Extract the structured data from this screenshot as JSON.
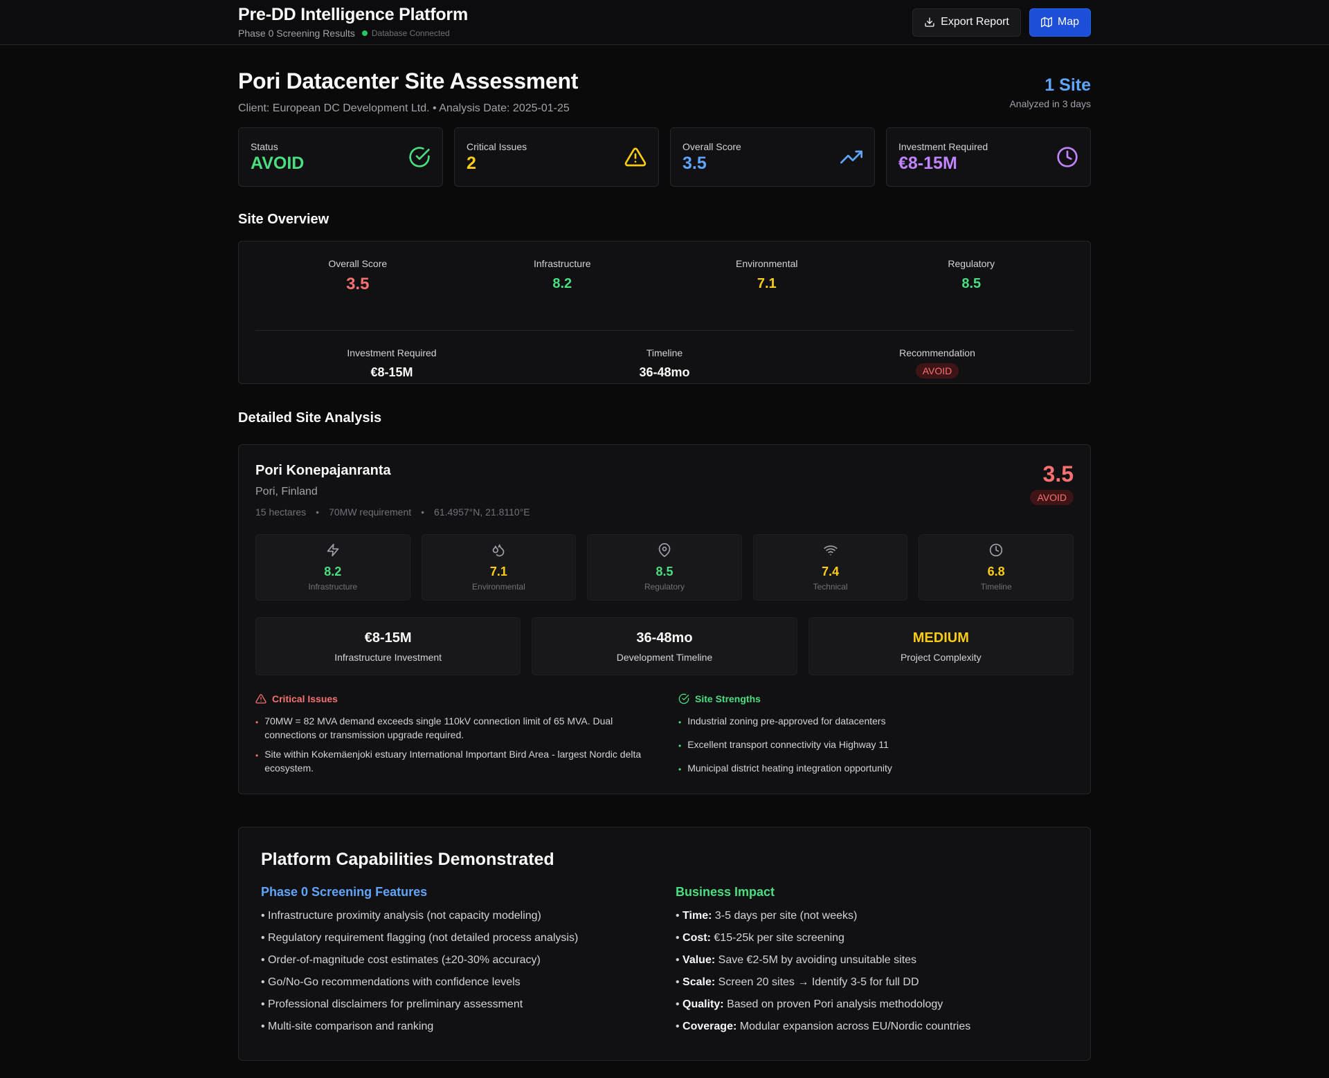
{
  "header": {
    "title": "Pre-DD Intelligence Platform",
    "phase": "Phase 0 Screening Results",
    "db_status": "Database Connected",
    "export_label": "Export Report",
    "map_label": "Map"
  },
  "assessment": {
    "title": "Pori Datacenter Site Assessment",
    "subtitle": "Client: European DC Development Ltd. • Analysis Date: 2025-01-25",
    "site_count": "1 Site",
    "analyzed": "Analyzed in 3 days"
  },
  "kpis": [
    {
      "label": "Status",
      "value": "AVOID",
      "color": "#4ade80",
      "icon": "check-circle-icon"
    },
    {
      "label": "Critical Issues",
      "value": "2",
      "color": "#facc15",
      "icon": "warning-triangle-icon"
    },
    {
      "label": "Overall Score",
      "value": "3.5",
      "color": "#60a5fa",
      "icon": "trending-up-icon"
    },
    {
      "label": "Investment Required",
      "value": "€8-15M",
      "color": "#c084fc",
      "icon": "clock-icon"
    }
  ],
  "overview": {
    "heading": "Site Overview",
    "scores": [
      {
        "label": "Overall Score",
        "value": "3.5",
        "color": "#f87171"
      },
      {
        "label": "Infrastructure",
        "value": "8.2",
        "color": "#4ade80"
      },
      {
        "label": "Environmental",
        "value": "7.1",
        "color": "#facc15"
      },
      {
        "label": "Regulatory",
        "value": "8.5",
        "color": "#4ade80"
      }
    ],
    "investment_label": "Investment Required",
    "investment_value": "€8-15M",
    "timeline_label": "Timeline",
    "timeline_value": "36-48mo",
    "recommendation_label": "Recommendation",
    "recommendation_value": "AVOID"
  },
  "detail": {
    "heading": "Detailed Site Analysis",
    "site_name": "Pori Konepajanranta",
    "location": "Pori, Finland",
    "area": "15 hectares",
    "power": "70MW requirement",
    "coords": "61.4957°N, 21.8110°E",
    "score": "3.5",
    "badge": "AVOID",
    "metrics": [
      {
        "label": "Infrastructure",
        "value": "8.2",
        "color": "#4ade80",
        "icon": "lightning-icon"
      },
      {
        "label": "Environmental",
        "value": "7.1",
        "color": "#facc15",
        "icon": "droplets-icon"
      },
      {
        "label": "Regulatory",
        "value": "8.5",
        "color": "#4ade80",
        "icon": "map-pin-icon"
      },
      {
        "label": "Technical",
        "value": "7.4",
        "color": "#facc15",
        "icon": "wifi-icon"
      },
      {
        "label": "Timeline",
        "value": "6.8",
        "color": "#facc15",
        "icon": "clock-icon"
      }
    ],
    "summary": [
      {
        "value": "€8-15M",
        "label": "Infrastructure Investment",
        "color": "#fafafa"
      },
      {
        "value": "36-48mo",
        "label": "Development Timeline",
        "color": "#fafafa"
      },
      {
        "value": "MEDIUM",
        "label": "Project Complexity",
        "color": "#facc15"
      }
    ],
    "critical_heading": "Critical Issues",
    "critical_items": [
      "70MW = 82 MVA demand exceeds single 110kV connection limit of 65 MVA. Dual connections or transmission upgrade required.",
      "Site within Kokemäenjoki estuary International Important Bird Area - largest Nordic delta ecosystem."
    ],
    "strengths_heading": "Site Strengths",
    "strength_items": [
      "Industrial zoning pre-approved for datacenters",
      "Excellent transport connectivity via Highway 11",
      "Municipal district heating integration opportunity"
    ]
  },
  "capabilities": {
    "title": "Platform Capabilities Demonstrated",
    "features_heading": "Phase 0 Screening Features",
    "features": [
      "Infrastructure proximity analysis (not capacity modeling)",
      "Regulatory requirement flagging (not detailed process analysis)",
      "Order-of-magnitude cost estimates (±20-30% accuracy)",
      "Go/No-Go recommendations with confidence levels",
      "Professional disclaimers for preliminary assessment",
      "Multi-site comparison and ranking"
    ],
    "impact_heading": "Business Impact",
    "impact": [
      {
        "k": "Time:",
        "v": "3-5 days per site (not weeks)"
      },
      {
        "k": "Cost:",
        "v": "€15-25k per site screening"
      },
      {
        "k": "Value:",
        "v": "Save €2-5M by avoiding unsuitable sites"
      },
      {
        "k": "Scale:",
        "v": "Screen 20 sites → Identify 3-5 for full DD"
      },
      {
        "k": "Quality:",
        "v": "Based on proven Pori analysis methodology"
      },
      {
        "k": "Coverage:",
        "v": "Modular expansion across EU/Nordic countries"
      }
    ]
  }
}
